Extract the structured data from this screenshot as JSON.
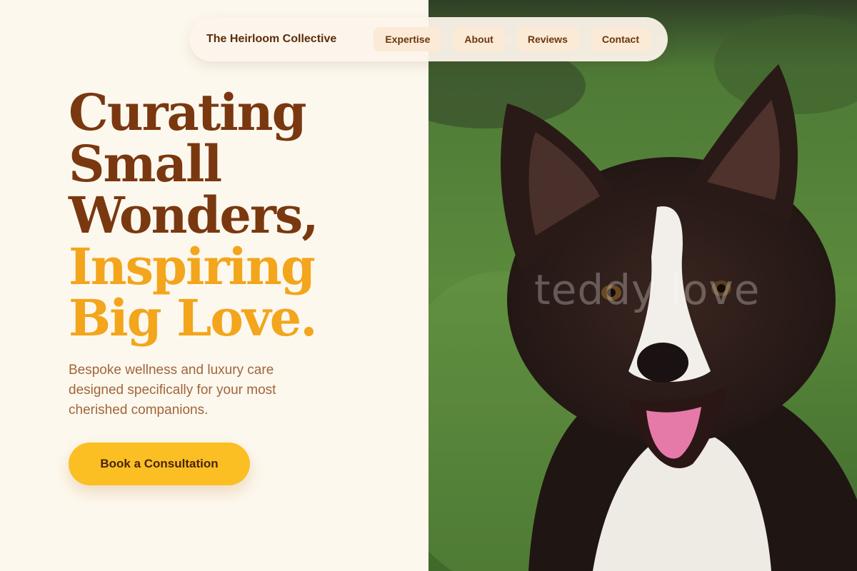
{
  "nav": {
    "brand": "The Heirloom Collective",
    "links": [
      "Expertise",
      "About",
      "Reviews",
      "Contact"
    ]
  },
  "hero": {
    "title_lines": [
      "Curating",
      "Small",
      "Wonders,"
    ],
    "accent_lines": [
      "Inspiring",
      "Big Love."
    ],
    "subtitle": "Bespoke wellness and luxury care designed specifically for your most cherished companions.",
    "cta_label": "Book a Consultation"
  },
  "photo": {
    "watermark": "teddy love",
    "subject": "border collie dog on grass"
  },
  "colors": {
    "background": "#fdf8ee",
    "brown": "#7a3810",
    "gold": "#f3a51c",
    "button": "#fbbf24",
    "nav_pill": "#fbead6"
  }
}
